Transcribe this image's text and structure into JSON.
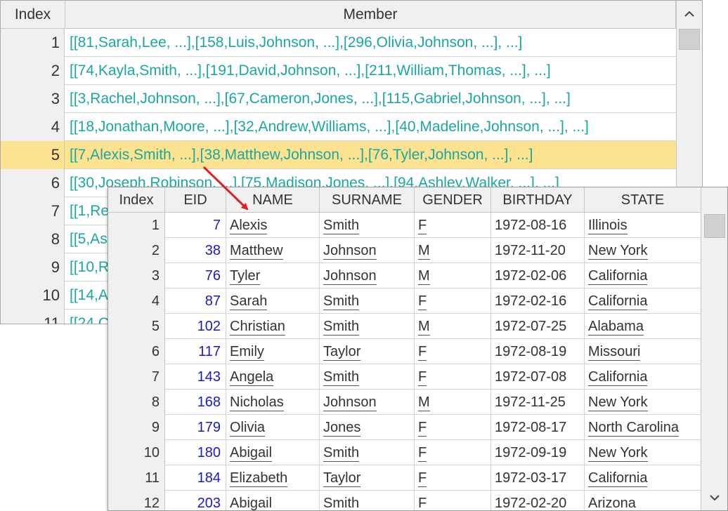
{
  "back_grid": {
    "headers": {
      "index": "Index",
      "member": "Member"
    },
    "selected_row": 4,
    "rows": [
      {
        "index": "1",
        "member": "[[81,Sarah,Lee, ...],[158,Luis,Johnson, ...],[296,Olivia,Johnson, ...], ...]"
      },
      {
        "index": "2",
        "member": "[[74,Kayla,Smith, ...],[191,David,Johnson, ...],[211,William,Thomas, ...], ...]"
      },
      {
        "index": "3",
        "member": "[[3,Rachel,Johnson, ...],[67,Cameron,Jones, ...],[115,Gabriel,Johnson, ...], ...]"
      },
      {
        "index": "4",
        "member": "[[18,Jonathan,Moore, ...],[32,Andrew,Williams, ...],[40,Madeline,Johnson, ...], ...]"
      },
      {
        "index": "5",
        "member": "[[7,Alexis,Smith, ...],[38,Matthew,Johnson, ...],[76,Tyler,Johnson, ...], ...]"
      },
      {
        "index": "6",
        "member": "[[30,Joseph,Robinson, ...],[75,Madison,Jones, ...],[94,Ashley,Walker, ...], ...]"
      },
      {
        "index": "7",
        "member": "[[1,Re"
      },
      {
        "index": "8",
        "member": "[[5,As"
      },
      {
        "index": "9",
        "member": "[[10,R"
      },
      {
        "index": "10",
        "member": "[[14,A"
      },
      {
        "index": "11",
        "member": "[[24,C"
      }
    ],
    "scroll_up_icon": "chevron-up-icon"
  },
  "front_grid": {
    "headers": {
      "index": "Index",
      "eid": "EID",
      "name": "NAME",
      "surname": "SURNAME",
      "gender": "GENDER",
      "birthday": "BIRTHDAY",
      "state": "STATE"
    },
    "rows": [
      {
        "index": "1",
        "eid": "7",
        "name": "Alexis",
        "surname": "Smith",
        "gender": "F",
        "birthday": "1972-08-16",
        "state": "Illinois"
      },
      {
        "index": "2",
        "eid": "38",
        "name": "Matthew",
        "surname": "Johnson",
        "gender": "M",
        "birthday": "1972-11-20",
        "state": "New York"
      },
      {
        "index": "3",
        "eid": "76",
        "name": "Tyler",
        "surname": "Johnson",
        "gender": "M",
        "birthday": "1972-02-06",
        "state": "California"
      },
      {
        "index": "4",
        "eid": "87",
        "name": "Sarah",
        "surname": "Smith",
        "gender": "F",
        "birthday": "1972-02-16",
        "state": "California"
      },
      {
        "index": "5",
        "eid": "102",
        "name": "Christian",
        "surname": "Smith",
        "gender": "M",
        "birthday": "1972-07-25",
        "state": "Alabama"
      },
      {
        "index": "6",
        "eid": "117",
        "name": "Emily",
        "surname": "Taylor",
        "gender": "F",
        "birthday": "1972-08-19",
        "state": "Missouri"
      },
      {
        "index": "7",
        "eid": "143",
        "name": "Angela",
        "surname": "Smith",
        "gender": "F",
        "birthday": "1972-07-08",
        "state": "California"
      },
      {
        "index": "8",
        "eid": "168",
        "name": "Nicholas",
        "surname": "Johnson",
        "gender": "M",
        "birthday": "1972-11-25",
        "state": "New York"
      },
      {
        "index": "9",
        "eid": "179",
        "name": "Olivia",
        "surname": "Jones",
        "gender": "F",
        "birthday": "1972-08-17",
        "state": "North Carolina"
      },
      {
        "index": "10",
        "eid": "180",
        "name": "Abigail",
        "surname": "Smith",
        "gender": "F",
        "birthday": "1972-09-19",
        "state": "New York"
      },
      {
        "index": "11",
        "eid": "184",
        "name": "Elizabeth",
        "surname": "Taylor",
        "gender": "F",
        "birthday": "1972-03-17",
        "state": "California"
      },
      {
        "index": "12",
        "eid": "203",
        "name": "Abigail",
        "surname": "Smith",
        "gender": "F",
        "birthday": "1972-02-20",
        "state": "Arizona"
      }
    ],
    "scroll_icon": "chevron-down-icon"
  },
  "colors": {
    "member_text": "#1aa7a2",
    "eid_text": "#1a1acc",
    "selected_row": "#fde38f",
    "arrow": "#e02020"
  }
}
